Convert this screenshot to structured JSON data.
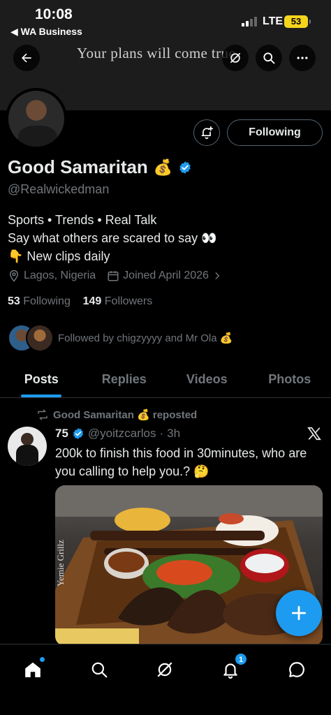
{
  "status_bar": {
    "time": "10:08",
    "back_app": "◀ WA Business",
    "network": "LTE",
    "battery": "53"
  },
  "banner": {
    "text": "Your plans will come true."
  },
  "profile": {
    "name": "Good Samaritan",
    "name_emoji": "💰",
    "handle": "@Realwickedman",
    "bio_lines": [
      "Sports • Trends • Real Talk",
      "Say what others are scared to say 👀",
      "👇 New clips daily"
    ],
    "location": "Lagos, Nigeria",
    "joined": "Joined April 2026",
    "following_count": "53",
    "following_label": "Following",
    "followers_count": "149",
    "followers_label": "Followers",
    "followed_by": "Followed by chigzyyyy and Mr Ola 💰",
    "follow_button": "Following"
  },
  "tabs": [
    {
      "label": "Posts",
      "active": true
    },
    {
      "label": "Replies",
      "active": false
    },
    {
      "label": "Videos",
      "active": false
    },
    {
      "label": "Photos",
      "active": false
    }
  ],
  "post": {
    "repost_label": "Good Samaritan 💰 reposted",
    "author_name": "75",
    "author_handle": "@yoitzcarlos",
    "time": "3h",
    "text": "200k to finish this food in 30minutes, who are you calling to help you.? 🤔",
    "image_watermark": "Yemie Grillz"
  },
  "nav": {
    "notifications_badge": "1"
  },
  "colors": {
    "accent": "#1d9bf0",
    "muted": "#71767b",
    "text": "#e7e9ea"
  },
  "icons": [
    "back-arrow-icon",
    "grok-icon",
    "search-icon",
    "more-icon",
    "bell-plus-icon",
    "verified-icon",
    "location-icon",
    "calendar-icon",
    "chevron-right-icon",
    "repost-icon",
    "x-logo-icon",
    "plus-icon",
    "home-icon",
    "notifications-icon",
    "messages-icon"
  ]
}
